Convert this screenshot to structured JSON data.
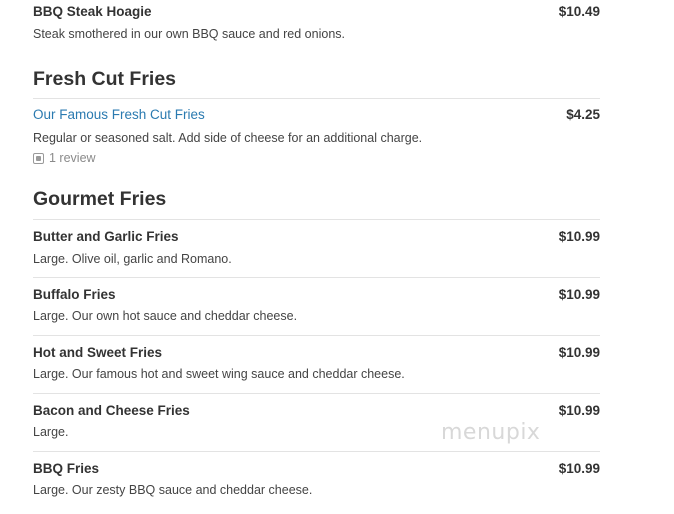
{
  "items_top": [
    {
      "name": "BBQ Steak Hoagie",
      "price": "$10.49",
      "desc": "Steak smothered in our own BBQ sauce and red onions."
    }
  ],
  "sections": [
    {
      "title": "Fresh Cut Fries",
      "items": [
        {
          "name": "Our Famous Fresh Cut Fries",
          "price": "$4.25",
          "desc": "Regular or seasoned salt. Add side of cheese for an additional charge.",
          "review": "1 review"
        }
      ]
    },
    {
      "title": "Gourmet Fries",
      "items": [
        {
          "name": "Butter and Garlic Fries",
          "price": "$10.99",
          "desc": "Large. Olive oil, garlic and Romano."
        },
        {
          "name": "Buffalo Fries",
          "price": "$10.99",
          "desc": "Large. Our own hot sauce and cheddar cheese."
        },
        {
          "name": "Hot and Sweet Fries",
          "price": "$10.99",
          "desc": "Large. Our famous hot and sweet wing sauce and cheddar cheese."
        },
        {
          "name": "Bacon and Cheese Fries",
          "price": "$10.99",
          "desc": "Large."
        },
        {
          "name": "BBQ Fries",
          "price": "$10.99",
          "desc": "Large. Our zesty BBQ sauce and cheddar cheese."
        }
      ]
    }
  ],
  "watermark": "menupix",
  "colors": {
    "link": "#2a7ab0",
    "text": "#333333",
    "divider": "#e3e3e3",
    "muted": "#8a8a8a"
  },
  "icons": {
    "review": "review-icon"
  }
}
